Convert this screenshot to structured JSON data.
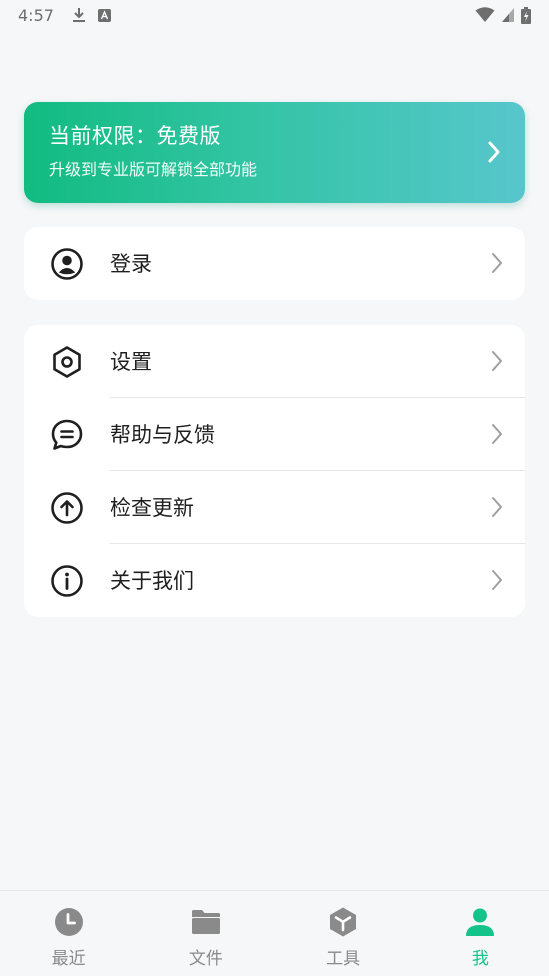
{
  "status_bar": {
    "time": "4:57",
    "left_icons": [
      "download-icon",
      "a-badge-icon"
    ],
    "right_icons": [
      "wifi-icon",
      "cellular-icon",
      "battery-icon"
    ]
  },
  "premium": {
    "title": "当前权限：免费版",
    "subtitle": "升级到专业版可解锁全部功能",
    "gradient": [
      "#11bb80",
      "#57c6cc"
    ]
  },
  "login": {
    "label": "登录",
    "icon": "user-circle-icon"
  },
  "menu": [
    {
      "label": "设置",
      "icon": "settings-hexagon-icon"
    },
    {
      "label": "帮助与反馈",
      "icon": "feedback-chat-icon"
    },
    {
      "label": "检查更新",
      "icon": "update-arrow-icon"
    },
    {
      "label": "关于我们",
      "icon": "info-icon"
    }
  ],
  "bottom_nav": [
    {
      "label": "最近",
      "icon": "clock-icon",
      "active": false
    },
    {
      "label": "文件",
      "icon": "folder-icon",
      "active": false
    },
    {
      "label": "工具",
      "icon": "toolbox-cube-icon",
      "active": false
    },
    {
      "label": "我",
      "icon": "person-icon",
      "active": true
    }
  ],
  "colors": {
    "accent": "#14c389",
    "inactive_nav": "#8a8a8a",
    "background": "#f6f7f9"
  }
}
